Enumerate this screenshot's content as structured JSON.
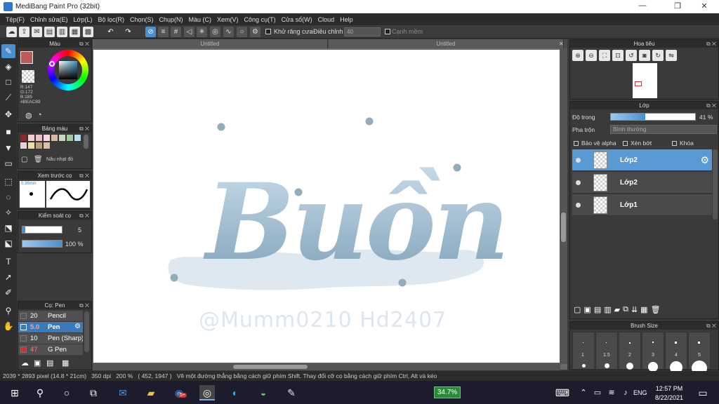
{
  "window": {
    "title": "MediBang Paint Pro (32bit)",
    "minimize": "—",
    "restore": "❐",
    "close": "✕"
  },
  "menu": [
    "Tệp(F)",
    "Chỉnh sửa(E)",
    "Lớp(L)",
    "Bộ lọc(R)",
    "Chọn(S)",
    "Chụp(N)",
    "Màu (C)",
    "Xem(V)",
    "Công cụ(T)",
    "Cửa sổ(W)",
    "Cloud",
    "Help"
  ],
  "toolbar": {
    "antialias_label": "Khử răng cưa",
    "correction_label": "Điều chỉnh",
    "correction_value": "40",
    "edge_label": "Cạnh mềm"
  },
  "color_panel": {
    "title": "Màu",
    "r": "R:147",
    "g": "G:172",
    "b": "B:185",
    "hex": "#BEAC89",
    "accent": "#93acb9"
  },
  "palette_panel": {
    "title": "Bảng màu",
    "sync_label": "Nâu nhạt đỏ",
    "swatches": [
      "#8b2a2a",
      "#f4cfcf",
      "#f0c0c8",
      "#f8d8e0",
      "#d8b8a8",
      "#c8d8c0",
      "#a0c8a0",
      "#b8e0e8",
      "#e8d0e0",
      "#f0e0a0",
      "#c0a070",
      "#d8c0a8"
    ]
  },
  "brush_preview": {
    "title": "Xem trước cọ",
    "size": "0.36mm"
  },
  "brush_control": {
    "title": "Kiểm soát cọ",
    "size_value": "5",
    "opacity_value": "100 %"
  },
  "brush_list": {
    "title": "Cọ: Pen",
    "items": [
      {
        "size": "20",
        "name": "Pencil",
        "color": "#555555"
      },
      {
        "size": "5.0",
        "name": "Pen",
        "color": "#3a7ab8",
        "active": true
      },
      {
        "size": "10",
        "name": "Pen (Sharp)",
        "color": "#555555"
      },
      {
        "size": "47",
        "name": "G Pen",
        "color": "#d03030"
      }
    ]
  },
  "tabs": [
    "Untitled",
    "Untitled"
  ],
  "canvas": {
    "main_word": "Buồn",
    "signature": "@Mumm0210 Hd2407",
    "ink": "#93acb9"
  },
  "navigator": {
    "title": "Hoa tiêu"
  },
  "layer_panel": {
    "title": "Lớp",
    "opacity_label": "Độ trong",
    "opacity_value": "41 %",
    "opacity": 0.41,
    "blend_label": "Pha trộn",
    "blend_value": "Bình thường",
    "protect_alpha": "Bảo vệ alpha",
    "clipping": "Xén bớt",
    "lock": "Khóa",
    "layers": [
      {
        "name": "Lớp2",
        "active": true
      },
      {
        "name": "Lớp2",
        "active": false
      },
      {
        "name": "Lớp1",
        "active": false
      }
    ]
  },
  "brush_size": {
    "title": "Brush Size",
    "sizes": [
      "1",
      "1.5",
      "2",
      "3",
      "4",
      "5"
    ]
  },
  "status": {
    "dims": "2039 * 2893 pixel",
    "cm": "(14.8 * 21cm)",
    "dpi": "350 dpi",
    "zoom": "200 %",
    "coords": "( 452, 1947 )",
    "hint": "Vẽ một đường thẳng bằng cách giữ phím Shift. Thay đổi cỡ cọ bằng cách giữ phím Ctrl, Alt và kéo"
  },
  "taskbar": {
    "battery": "34.7%",
    "lang": "ENG",
    "time": "12:57 PM",
    "date": "8/22/2021",
    "badge": "5+"
  }
}
